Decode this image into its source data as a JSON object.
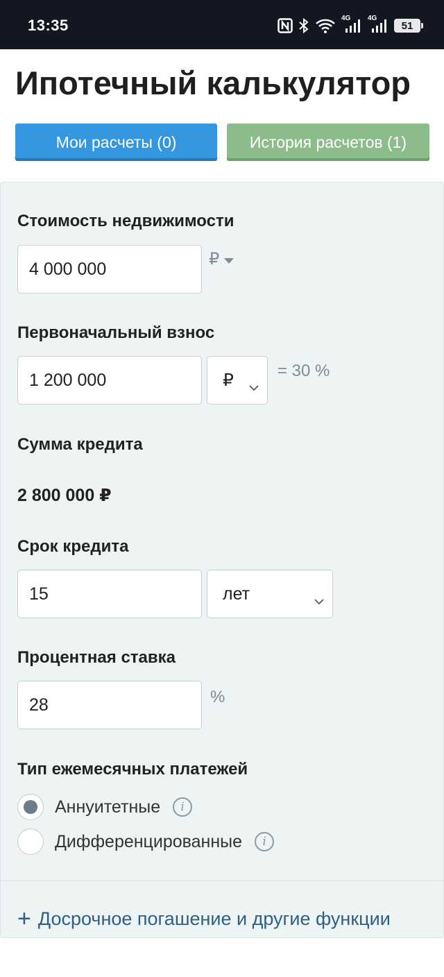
{
  "status_bar": {
    "time": "13:35",
    "icons": [
      "nfc-icon",
      "bluetooth-icon",
      "wifi-icon",
      "signal-4g-icon",
      "signal-4g-icon"
    ],
    "network_label": "4G",
    "battery_level": "51"
  },
  "page": {
    "title": "Ипотечный калькулятор"
  },
  "tabs": {
    "my_calculations": "Мои расчеты (0)",
    "history": "История расчетов (1)"
  },
  "form": {
    "property_cost": {
      "label": "Стоимость недвижимости",
      "value": "4 000 000",
      "currency": "₽"
    },
    "down_payment": {
      "label": "Первоначальный взнос",
      "value": "1 200 000",
      "unit_selected": "₽",
      "percent_text": "= 30 %"
    },
    "loan_amount": {
      "label": "Сумма кредита",
      "value": "2 800 000 ₽"
    },
    "loan_term": {
      "label": "Срок кредита",
      "value": "15",
      "unit_selected": "лет"
    },
    "interest_rate": {
      "label": "Процентная ставка",
      "value": "28",
      "unit": "%"
    },
    "payment_type": {
      "label": "Тип ежемесячных платежей",
      "options": [
        {
          "label": "Аннуитетные",
          "selected": true
        },
        {
          "label": "Дифференцированные",
          "selected": false
        }
      ]
    }
  },
  "more_options": {
    "icon": "plus-icon",
    "label": "Досрочное погашение и другие функции"
  },
  "colors": {
    "tab_my_bg": "#3597df",
    "tab_history_bg": "#8dbc8b",
    "panel_bg": "#eef3f4",
    "link": "#2f5f86"
  }
}
